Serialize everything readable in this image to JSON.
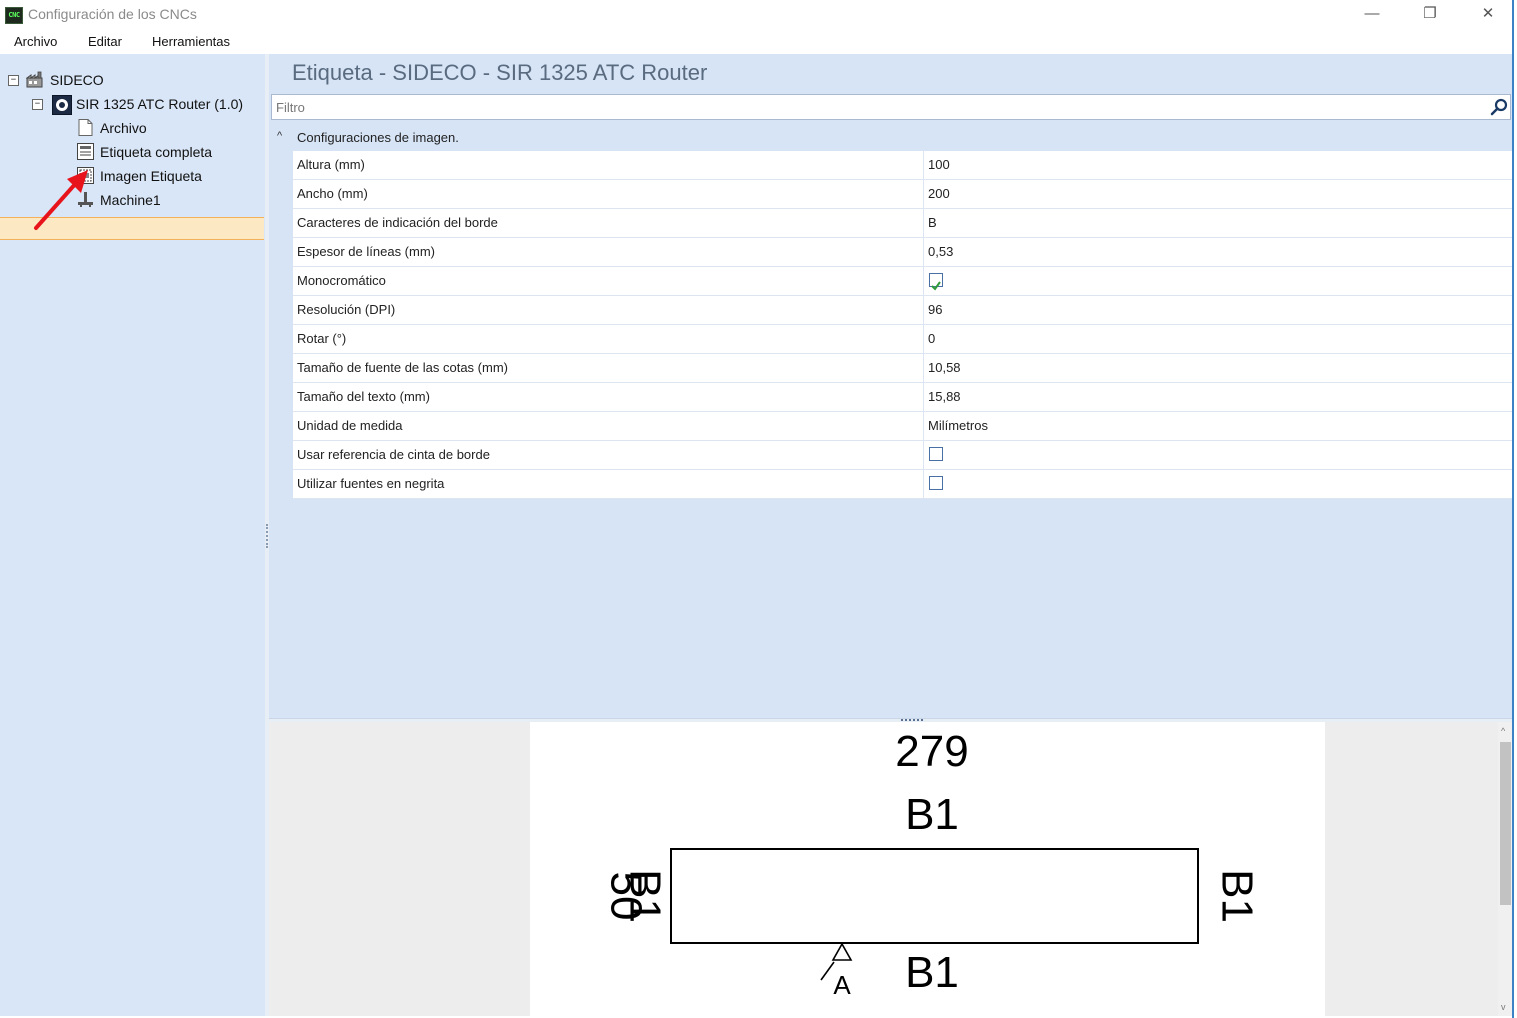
{
  "window": {
    "title": "Configuración de los CNCs",
    "app_icon_text": "CNC",
    "minimize": "—",
    "restore": "❐",
    "close": "✕"
  },
  "menu": {
    "archivo": "Archivo",
    "editar": "Editar",
    "herramientas": "Herramientas"
  },
  "tree": {
    "root": "SIDECO",
    "machine": "SIR 1325 ATC Router (1.0)",
    "items": [
      "Archivo",
      "Etiqueta completa",
      "Imagen Etiqueta",
      "Machine1"
    ],
    "selected": "Imagen Etiqueta"
  },
  "panel": {
    "title": "Etiqueta - SIDECO - SIR 1325 ATC Router",
    "filter_placeholder": "Filtro",
    "group": "Configuraciones de imagen."
  },
  "properties": [
    {
      "name": "Altura (mm)",
      "value": "100"
    },
    {
      "name": "Ancho (mm)",
      "value": "200"
    },
    {
      "name": "Caracteres de indicación del borde",
      "value": "B"
    },
    {
      "name": "Espesor de líneas (mm)",
      "value": "0,53"
    },
    {
      "name": "Monocromático",
      "value": "",
      "checkbox": true,
      "checked": true
    },
    {
      "name": "Resolución (DPI)",
      "value": "96"
    },
    {
      "name": "Rotar (°)",
      "value": "0"
    },
    {
      "name": "Tamaño de fuente de las cotas (mm)",
      "value": "10,58"
    },
    {
      "name": "Tamaño del texto (mm)",
      "value": "15,88"
    },
    {
      "name": "Unidad de medida",
      "value": "Milímetros"
    },
    {
      "name": "Usar referencia de cinta de borde",
      "value": "",
      "checkbox": true,
      "checked": false
    },
    {
      "name": "Utilizar fuentes en negrita",
      "value": "",
      "checkbox": true,
      "checked": false
    }
  ],
  "preview": {
    "width_label": "279",
    "height_label": "50",
    "edge_top": "B1",
    "edge_bottom": "B1",
    "edge_left": "B1",
    "edge_right": "B1",
    "grain_marker": "A"
  },
  "colors": {
    "pane_bg": "#d6e4f6",
    "selection": "#fde8c4",
    "annotation_arrow": "#e8141c"
  }
}
